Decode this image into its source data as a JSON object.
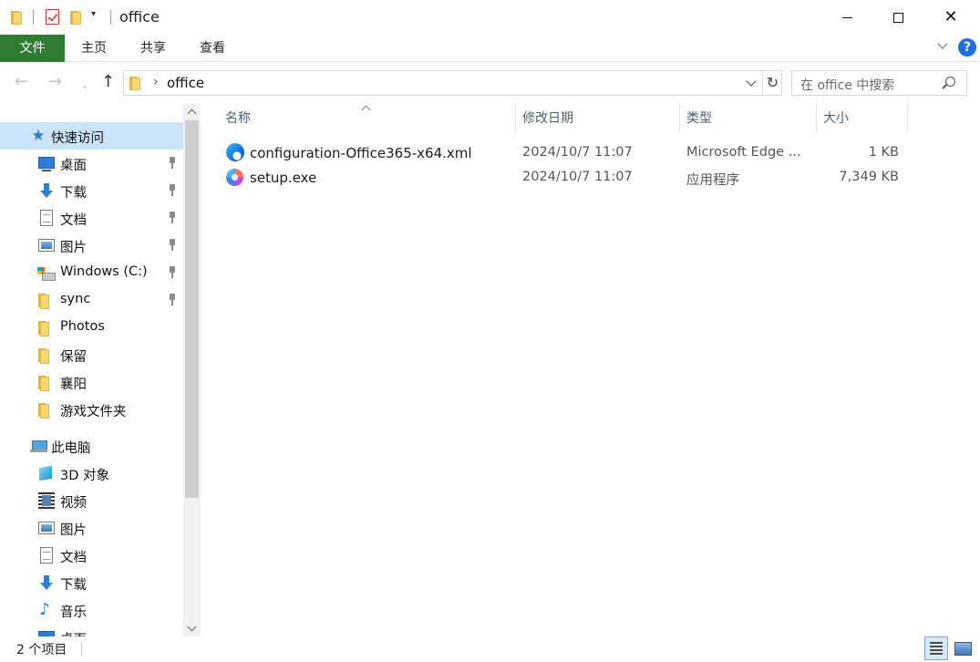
{
  "window": {
    "title": "office",
    "minimize_glyph": "",
    "close_glyph": "✕"
  },
  "ribbon": {
    "tabs": [
      "文件",
      "主页",
      "共享",
      "查看"
    ],
    "help": "?"
  },
  "navigation": {
    "back": "←",
    "forward": "→",
    "up": "↑",
    "address_path": "office",
    "refresh": "↻",
    "search_placeholder": "在 office 中搜索"
  },
  "sidebar": {
    "items": [
      {
        "label": "快速访问",
        "icon": "star-icon",
        "selected": true,
        "pinned": false
      },
      {
        "label": "桌面",
        "icon": "desktop-icon",
        "selected": false,
        "pinned": true
      },
      {
        "label": "下载",
        "icon": "download-icon",
        "selected": false,
        "pinned": true
      },
      {
        "label": "文档",
        "icon": "document-icon",
        "selected": false,
        "pinned": true
      },
      {
        "label": "图片",
        "icon": "pictures-icon",
        "selected": false,
        "pinned": true
      },
      {
        "label": "Windows (C:)",
        "icon": "drive-icon",
        "selected": false,
        "pinned": true
      },
      {
        "label": "sync",
        "icon": "folder-icon",
        "selected": false,
        "pinned": true
      },
      {
        "label": "Photos",
        "icon": "folder-icon",
        "selected": false,
        "pinned": false
      },
      {
        "label": "保留",
        "icon": "folder-icon",
        "selected": false,
        "pinned": false
      },
      {
        "label": "襄阳",
        "icon": "folder-icon",
        "selected": false,
        "pinned": false
      },
      {
        "label": "游戏文件夹",
        "icon": "folder-icon",
        "selected": false,
        "pinned": false
      },
      {
        "label": "此电脑",
        "icon": "computer-icon",
        "selected": false,
        "pinned": false
      },
      {
        "label": "3D 对象",
        "icon": "3d-objects-icon",
        "selected": false,
        "pinned": false
      },
      {
        "label": "视频",
        "icon": "video-icon",
        "selected": false,
        "pinned": false
      },
      {
        "label": "图片",
        "icon": "pictures-icon",
        "selected": false,
        "pinned": false
      },
      {
        "label": "文档",
        "icon": "document-icon",
        "selected": false,
        "pinned": false
      },
      {
        "label": "下载",
        "icon": "download-icon",
        "selected": false,
        "pinned": false
      },
      {
        "label": "音乐",
        "icon": "music-icon",
        "selected": false,
        "pinned": false
      },
      {
        "label": "桌面",
        "icon": "desktop-icon",
        "selected": false,
        "pinned": false
      }
    ]
  },
  "file_list": {
    "columns": [
      "名称",
      "修改日期",
      "类型",
      "大小"
    ],
    "files": [
      {
        "name": "configuration-Office365-x64.xml",
        "modified": "2024/10/7 11:07",
        "type": "Microsoft Edge ...",
        "size": "1 KB",
        "icon": "edge-icon"
      },
      {
        "name": "setup.exe",
        "modified": "2024/10/7 11:07",
        "type": "应用程序",
        "size": "7,349 KB",
        "icon": "microsoft365-icon"
      }
    ]
  },
  "status": {
    "item_count": "2 个项目"
  },
  "colors": {
    "file_tab": "#2e7d32",
    "selected_nav": "#cce4f7",
    "accent_blue": "#1e6fd9"
  }
}
